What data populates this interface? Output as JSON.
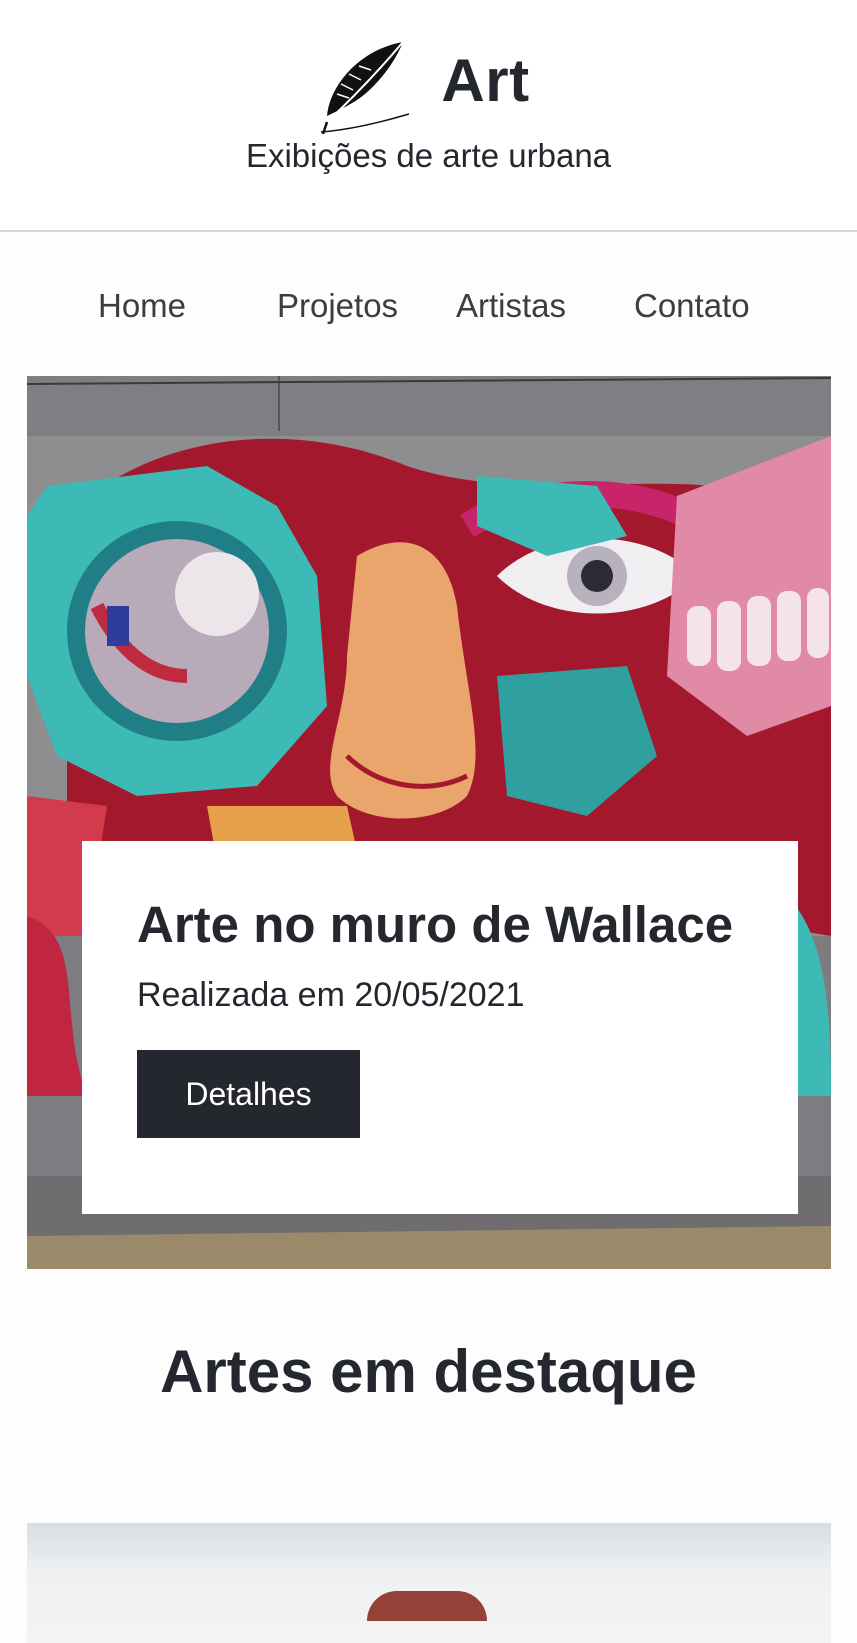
{
  "header": {
    "title": "Art",
    "tagline": "Exibições de arte urbana",
    "logo_icon": "feather-quill-icon"
  },
  "nav": {
    "items": [
      {
        "label": "Home"
      },
      {
        "label": "Projetos"
      },
      {
        "label": "Artistas"
      },
      {
        "label": "Contato"
      }
    ]
  },
  "hero": {
    "image": "graffiti-mural-image",
    "title": "Arte no muro de Wallace",
    "date": "Realizada em 20/05/2021",
    "button_label": "Detalhes"
  },
  "featured": {
    "title": "Artes em destaque",
    "first_card_image": "featured-art-image"
  },
  "colors": {
    "text": "#24272d",
    "button_bg": "#24272d",
    "button_text": "#ffffff",
    "divider": "#d6d6d6",
    "page_bg": "#fdfdfd"
  }
}
